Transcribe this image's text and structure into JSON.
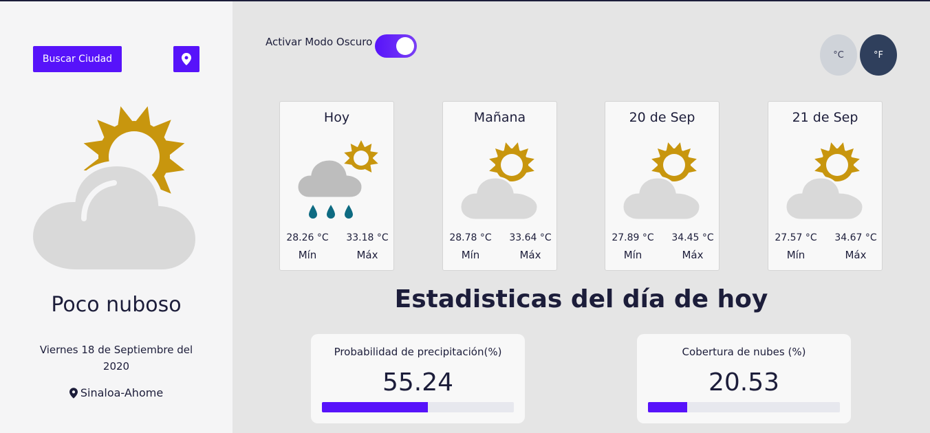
{
  "sidebar": {
    "search_button": "Buscar Ciudad",
    "location_button_icon": "map-pin-icon",
    "current_icon": "sun-behind-cloud-icon",
    "condition": "Poco nuboso",
    "date": "Viernes 18 de Septiembre del 2020",
    "location": "Sinaloa-Ahome"
  },
  "header": {
    "dark_mode_label": "Activar Modo Oscuro",
    "dark_mode_on": true,
    "unit_c": "°C",
    "unit_f": "°F"
  },
  "forecast": [
    {
      "day": "Hoy",
      "icon": "sun-cloud-rain-icon",
      "min": "28.26 °C",
      "max": "33.18 °C",
      "min_label": "Mín",
      "max_label": "Máx"
    },
    {
      "day": "Mañana",
      "icon": "sun-behind-cloud-icon",
      "min": "28.78 °C",
      "max": "33.64 °C",
      "min_label": "Mín",
      "max_label": "Máx"
    },
    {
      "day": "20 de Sep",
      "icon": "sun-behind-cloud-icon",
      "min": "27.89 °C",
      "max": "34.45 °C",
      "min_label": "Mín",
      "max_label": "Máx"
    },
    {
      "day": "21 de Sep",
      "icon": "sun-behind-cloud-icon",
      "min": "27.57 °C",
      "max": "34.67 °C",
      "min_label": "Mín",
      "max_label": "Máx"
    }
  ],
  "stats": {
    "title": "Estadisticas del día de hoy",
    "items": [
      {
        "label": "Probabilidad de precipitación(%)",
        "value": "55.24",
        "percent": 55.24
      },
      {
        "label": "Cobertura de nubes (%)",
        "value": "20.53",
        "percent": 20.53
      }
    ]
  },
  "colors": {
    "accent": "#5713fa",
    "sun": "#c8960e",
    "cloud": "#d9d9d9",
    "rain": "#0e6b82"
  }
}
